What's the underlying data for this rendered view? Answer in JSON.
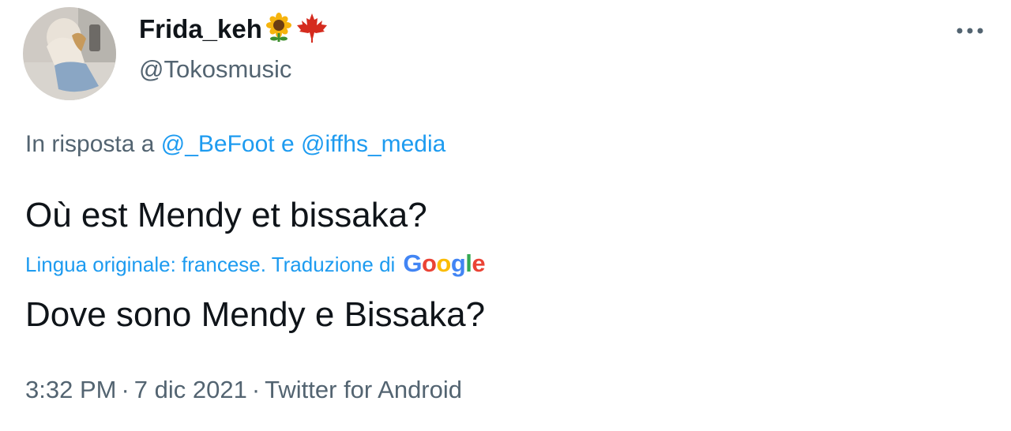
{
  "author": {
    "display_name": "Frida_keh",
    "emojis": [
      "sunflower",
      "maple-leaf"
    ],
    "handle": "@Tokosmusic"
  },
  "menu": {
    "more_icon": "more-horizontal-icon"
  },
  "reply": {
    "prefix": "In risposta a",
    "mention_1": "@_BeFoot",
    "conjunction": "e",
    "mention_2": "@iffhs_media"
  },
  "tweet": {
    "text": "Où est Mendy et bissaka?"
  },
  "translation": {
    "info": "Lingua originale: francese. Traduzione di",
    "provider": "Google",
    "text": "Dove sono Mendy e Bissaka?"
  },
  "meta": {
    "time": "3:32 PM",
    "date": "7 dic 2021",
    "source": "Twitter for Android"
  },
  "colors": {
    "link": "#1d9bf0",
    "secondary_text": "#536471",
    "primary_text": "#0f1419",
    "google_blue": "#4285f4",
    "google_red": "#ea4335",
    "google_yellow": "#fbbc05",
    "google_green": "#34a853"
  }
}
